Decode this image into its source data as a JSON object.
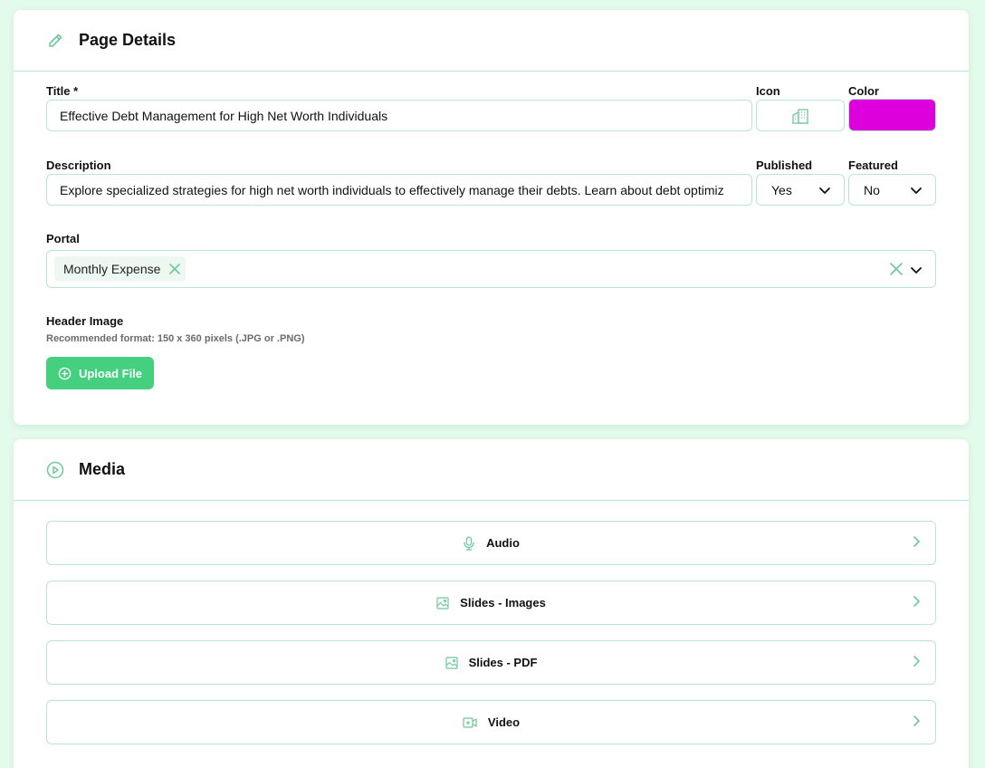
{
  "details": {
    "header_title": "Page Details",
    "title_label": "Title *",
    "title_value": "Effective Debt Management for High Net Worth Individuals",
    "icon_label": "Icon",
    "color_label": "Color",
    "color_value": "#dd00dd",
    "description_label": "Description",
    "description_value": "Explore specialized strategies for high net worth individuals to effectively manage their debts. Learn about debt optimiz",
    "published_label": "Published",
    "published_value": "Yes",
    "featured_label": "Featured",
    "featured_value": "No",
    "portal_label": "Portal",
    "portal_tags": [
      "Monthly Expense"
    ],
    "header_image_label": "Header Image",
    "header_image_hint": "Recommended format: 150 x 360 pixels (.JPG or .PNG)",
    "upload_label": "Upload File"
  },
  "media": {
    "header_title": "Media",
    "items": [
      {
        "label": "Audio",
        "icon": "microphone-icon"
      },
      {
        "label": "Slides - Images",
        "icon": "image-icon"
      },
      {
        "label": "Slides - PDF",
        "icon": "image-icon"
      },
      {
        "label": "Video",
        "icon": "video-camera-icon"
      }
    ]
  },
  "colors": {
    "accent": "#44d07e",
    "border": "#b9e6cf",
    "background": "#e3fbeb",
    "icon": "#6fc89a"
  }
}
